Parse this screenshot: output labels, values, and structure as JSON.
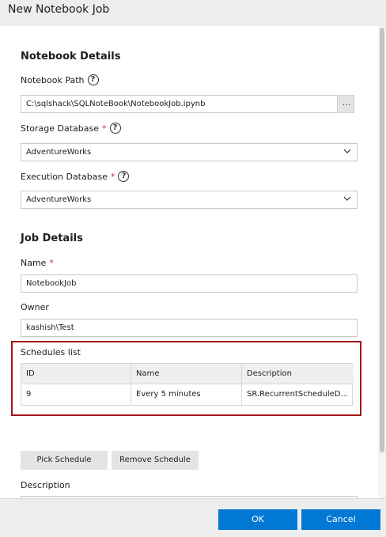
{
  "dialog": {
    "title": "New Notebook Job"
  },
  "notebook_details": {
    "heading": "Notebook Details",
    "path_label": "Notebook Path",
    "path_value": "C:\\sqlshack\\SQLNoteBook\\NotebookJob.ipynb",
    "browse_label": "...",
    "storage_db_label": "Storage Database",
    "storage_db_value": "AdventureWorks",
    "exec_db_label": "Execution Database",
    "exec_db_value": "AdventureWorks"
  },
  "job_details": {
    "heading": "Job Details",
    "name_label": "Name",
    "name_value": "NotebookJob",
    "owner_label": "Owner",
    "owner_value": "kashish\\Test"
  },
  "schedules": {
    "label": "Schedules list",
    "columns": [
      "ID",
      "Name",
      "Description"
    ],
    "rows": [
      [
        "9",
        "Every 5 minutes",
        "SR.RecurrentScheduleD..."
      ]
    ]
  },
  "actions": {
    "pick_schedule": "Pick Schedule",
    "remove_schedule": "Remove Schedule",
    "description_label": "Description"
  },
  "footer": {
    "ok": "OK",
    "cancel": "Cancel"
  },
  "required_marker": "*",
  "help_glyph": "?",
  "colors": {
    "accent": "#0078d4",
    "highlight_border": "#a31515"
  }
}
